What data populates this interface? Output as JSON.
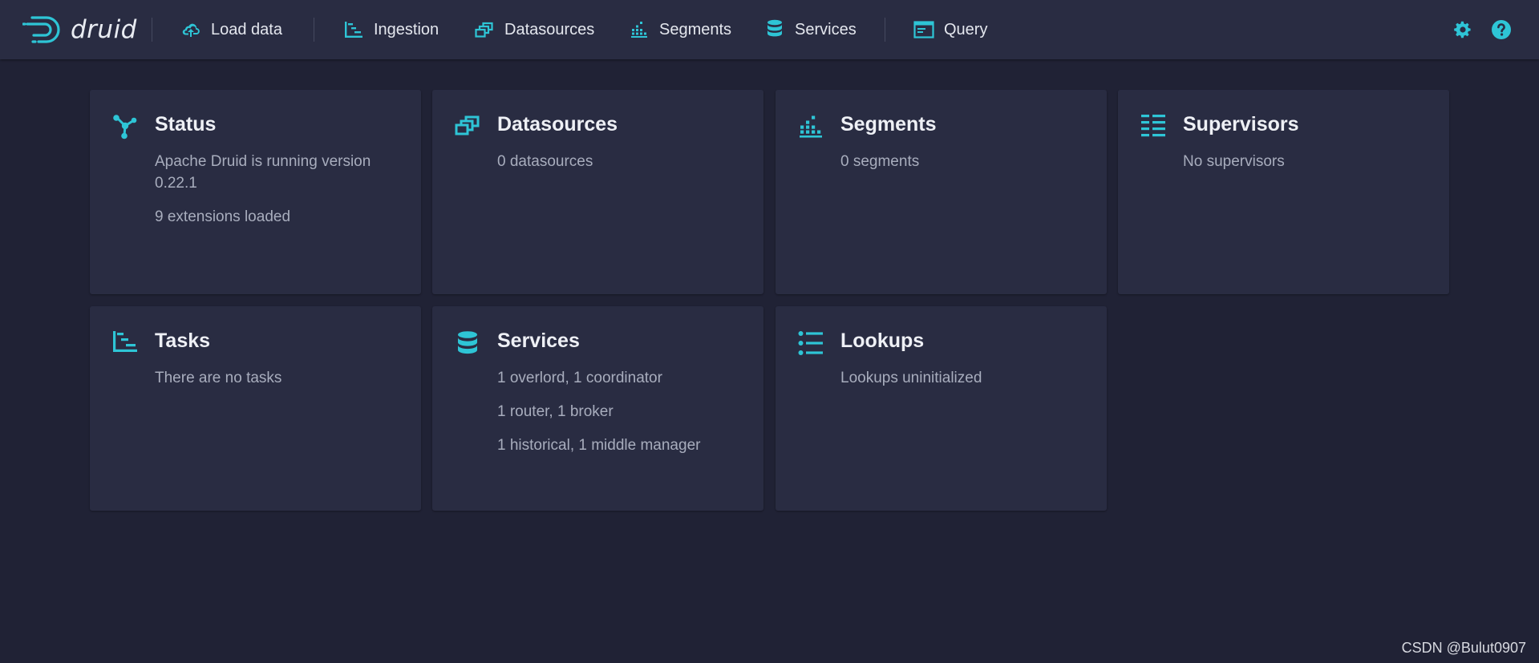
{
  "app": {
    "brand": "druid",
    "accent_color": "#2ec5d6"
  },
  "nav": {
    "items": [
      {
        "label": "Load data",
        "icon": "cloud-upload-icon"
      },
      {
        "label": "Ingestion",
        "icon": "gantt-chart-icon"
      },
      {
        "label": "Datasources",
        "icon": "multi-select-icon"
      },
      {
        "label": "Segments",
        "icon": "stacked-chart-icon"
      },
      {
        "label": "Services",
        "icon": "database-icon"
      },
      {
        "label": "Query",
        "icon": "application-icon"
      }
    ],
    "right_icons": [
      "cog-icon",
      "help-icon"
    ]
  },
  "cards": [
    {
      "title": "Status",
      "icon": "graph-icon",
      "lines": [
        "Apache Druid is running version 0.22.1",
        "9 extensions loaded"
      ]
    },
    {
      "title": "Datasources",
      "icon": "multi-select-icon",
      "lines": [
        "0 datasources"
      ]
    },
    {
      "title": "Segments",
      "icon": "stacked-chart-icon",
      "lines": [
        "0 segments"
      ]
    },
    {
      "title": "Supervisors",
      "icon": "list-columns-icon",
      "lines": [
        "No supervisors"
      ]
    },
    {
      "title": "Tasks",
      "icon": "gantt-chart-icon",
      "lines": [
        "There are no tasks"
      ]
    },
    {
      "title": "Services",
      "icon": "database-icon",
      "lines": [
        "1 overlord, 1 coordinator",
        "1 router, 1 broker",
        "1 historical, 1 middle manager"
      ]
    },
    {
      "title": "Lookups",
      "icon": "properties-icon",
      "lines": [
        "Lookups uninitialized"
      ]
    }
  ],
  "watermark": "CSDN @Bulut0907"
}
